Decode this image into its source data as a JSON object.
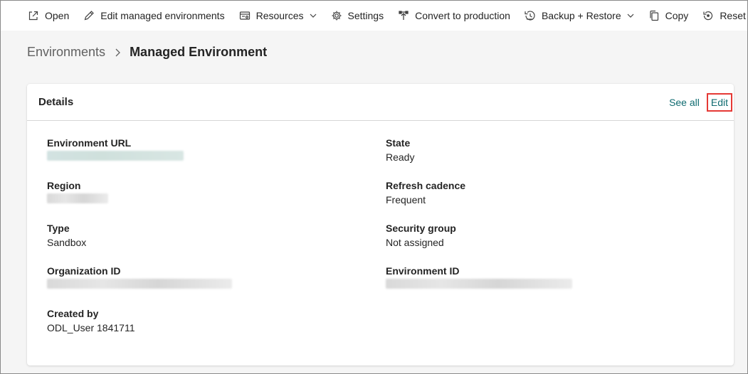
{
  "toolbar": {
    "items": [
      {
        "label": "Open",
        "icon": "open-external-icon"
      },
      {
        "label": "Edit managed environments",
        "icon": "pencil-icon"
      },
      {
        "label": "Resources",
        "icon": "resources-icon"
      },
      {
        "label": "Settings",
        "icon": "gear-icon"
      },
      {
        "label": "Convert to production",
        "icon": "convert-icon"
      },
      {
        "label": "Backup + Restore",
        "icon": "backup-restore-icon"
      },
      {
        "label": "Copy",
        "icon": "copy-icon"
      },
      {
        "label": "Reset",
        "icon": "reset-icon"
      }
    ]
  },
  "breadcrumb": {
    "parent": "Environments",
    "current": "Managed Environment"
  },
  "details": {
    "title": "Details",
    "see_all": "See all",
    "edit": "Edit",
    "environment_url_label": "Environment URL",
    "region_label": "Region",
    "type_label": "Type",
    "type_value": "Sandbox",
    "organization_id_label": "Organization ID",
    "created_by_label": "Created by",
    "created_by_value": "ODL_User 1841711",
    "state_label": "State",
    "state_value": "Ready",
    "refresh_cadence_label": "Refresh cadence",
    "refresh_cadence_value": "Frequent",
    "security_group_label": "Security group",
    "security_group_value": "Not assigned",
    "environment_id_label": "Environment ID"
  },
  "colors": {
    "accent_link": "#0f6b70",
    "highlight_border": "#e53935"
  }
}
